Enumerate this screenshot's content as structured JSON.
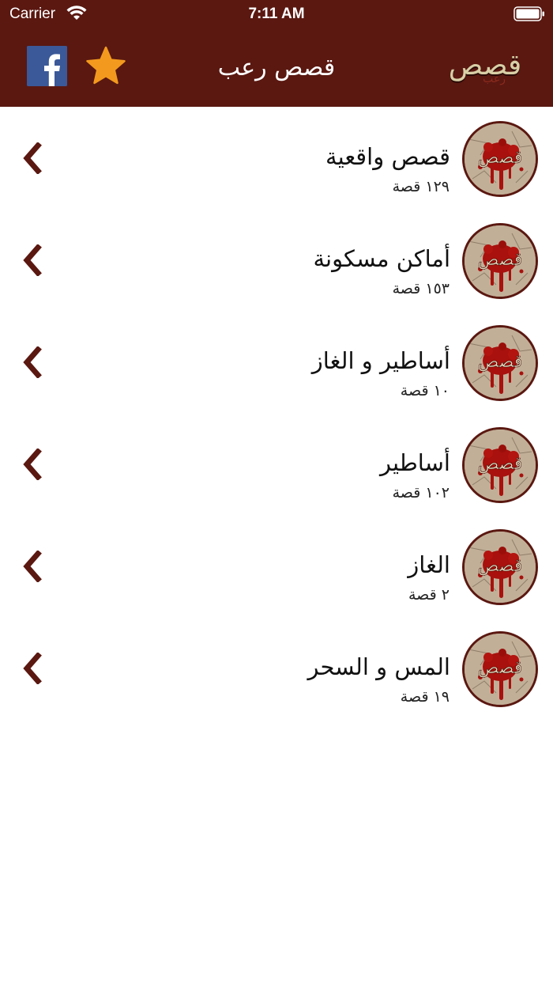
{
  "status_bar": {
    "carrier": "Carrier",
    "time": "7:11 AM"
  },
  "nav": {
    "title": "قصص رعب",
    "logo_text": "قصص",
    "logo_subtext": "رعب",
    "facebook_icon": "facebook-icon",
    "star_icon": "star-icon"
  },
  "colors": {
    "header_bg": "#5a1811",
    "chevron": "#5a1811",
    "star": "#f39a1e",
    "facebook": "#3b5998",
    "logo_text": "#d8cfa6"
  },
  "categories": [
    {
      "title": "قصص واقعية",
      "count": "١٢٩ قصة",
      "thumb_text": "قصص"
    },
    {
      "title": "أماكن مسكونة",
      "count": "١٥٣ قصة",
      "thumb_text": "قصص"
    },
    {
      "title": "أساطير و الغاز",
      "count": "١٠ قصة",
      "thumb_text": "قصص"
    },
    {
      "title": "أساطير",
      "count": "١٠٢ قصة",
      "thumb_text": "قصص"
    },
    {
      "title": "الغاز",
      "count": "٢ قصة",
      "thumb_text": "قصص"
    },
    {
      "title": "المس و السحر",
      "count": "١٩ قصة",
      "thumb_text": "قصص"
    }
  ]
}
